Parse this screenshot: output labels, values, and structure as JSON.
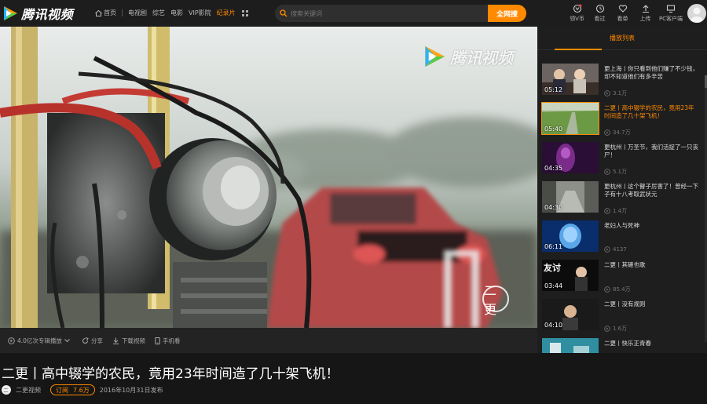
{
  "app": {
    "logo_text": "腾讯视频",
    "brand_color": "#ff8a00"
  },
  "nav": {
    "home": "首页",
    "items": [
      "电视剧",
      "综艺",
      "电影",
      "VIP影院"
    ],
    "active": "纪录片"
  },
  "search": {
    "placeholder": "搜索关键词",
    "button": "全网搜"
  },
  "tools": [
    {
      "label": "领V币",
      "icon": "vcoin-icon"
    },
    {
      "label": "看过",
      "icon": "history-icon"
    },
    {
      "label": "看单",
      "icon": "heart-icon"
    },
    {
      "label": "上传",
      "icon": "upload-icon"
    },
    {
      "label": "PC客户端",
      "icon": "monitor-icon"
    }
  ],
  "video": {
    "watermark": "腾讯视频",
    "stamp": "二更",
    "actions": {
      "plays": "4.0亿次专辑播放",
      "share": "分享",
      "download": "下载视频",
      "mobile": "手机看"
    },
    "title": "二更丨高中辍学的农民，竟用23年时间造了几十架飞机！",
    "uploader": "二更视频",
    "subscribe": "订阅",
    "subscribers": "7.6万",
    "date": "2016年10月31日发布"
  },
  "playlist": {
    "header": "播放列表",
    "items": [
      {
        "duration": "05:12",
        "title": "更上海丨你只看到他们赚了不少钱，却不知道他们有多辛苦",
        "count": "3.1万",
        "selected": false,
        "theme": "couple"
      },
      {
        "duration": "05:40",
        "title": "二更丨高中辍学的农民，竟用23年时间造了几十架飞机！",
        "count": "34.7万",
        "selected": true,
        "theme": "field"
      },
      {
        "duration": "04:35",
        "title": "更杭州丨万圣节，我们活捉了一只丧尸！",
        "count": "5.1万",
        "selected": false,
        "theme": "purple"
      },
      {
        "duration": "04:30",
        "title": "更杭州丨这个瞽子厉害了！曾经一下子有十八考取武状元",
        "count": "1.4万",
        "selected": false,
        "theme": "street"
      },
      {
        "duration": "06:11",
        "title": "老妇人与死神",
        "count": "4137",
        "selected": false,
        "theme": "blue"
      },
      {
        "duration": "03:44",
        "title": "二更丨其確也歌",
        "count": "85.4万",
        "selected": false,
        "theme": "singer"
      },
      {
        "duration": "04:10",
        "title": "二更丨没有规则",
        "count": "1.6万",
        "selected": false,
        "theme": "man"
      },
      {
        "duration": "",
        "title": "二更丨快乐正青春",
        "count": "",
        "selected": false,
        "theme": "cyan"
      }
    ]
  }
}
